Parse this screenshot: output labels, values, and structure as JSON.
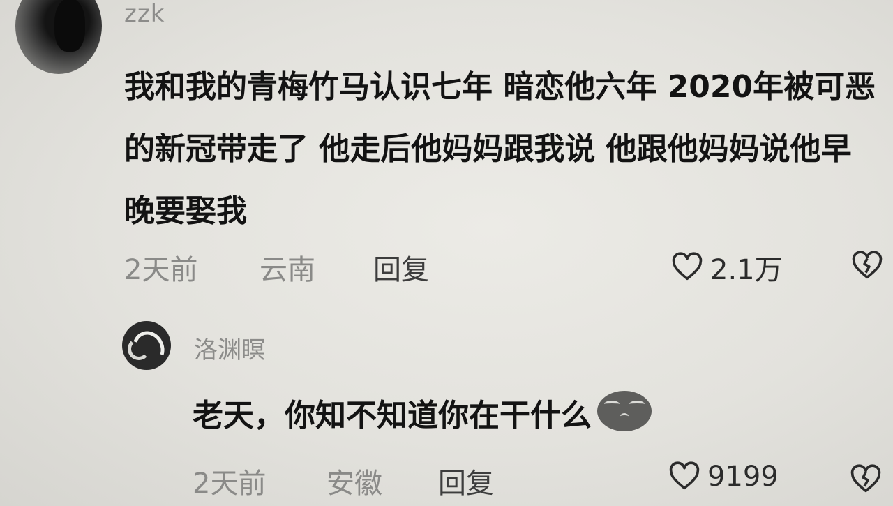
{
  "comments": [
    {
      "username": "zzk",
      "text": "我和我的青梅竹马认识七年 暗恋他六年 2020年被可恶的新冠带走了 他走后他妈妈跟我说 他跟他妈妈说他早晚要娶我",
      "time": "2天前",
      "location": "云南",
      "reply_label": "回复",
      "likes": "2.1万",
      "avatar_icon": "dark-portrait-avatar",
      "like_icon": "heart-outline-icon",
      "dislike_icon": "broken-heart-icon"
    },
    {
      "username": "洛渊瞑",
      "text": "老天，你知不知道你在干什么",
      "emoji_icon": "crying-face-emoji-icon",
      "time": "2天前",
      "location": "安徽",
      "reply_label": "回复",
      "likes": "9199",
      "avatar_icon": "swirl-logo-avatar",
      "like_icon": "heart-outline-icon",
      "dislike_icon": "broken-heart-icon"
    }
  ],
  "colors": {
    "background": "#e8e7e2",
    "text_primary": "#131313",
    "text_secondary": "#8a8a88"
  }
}
